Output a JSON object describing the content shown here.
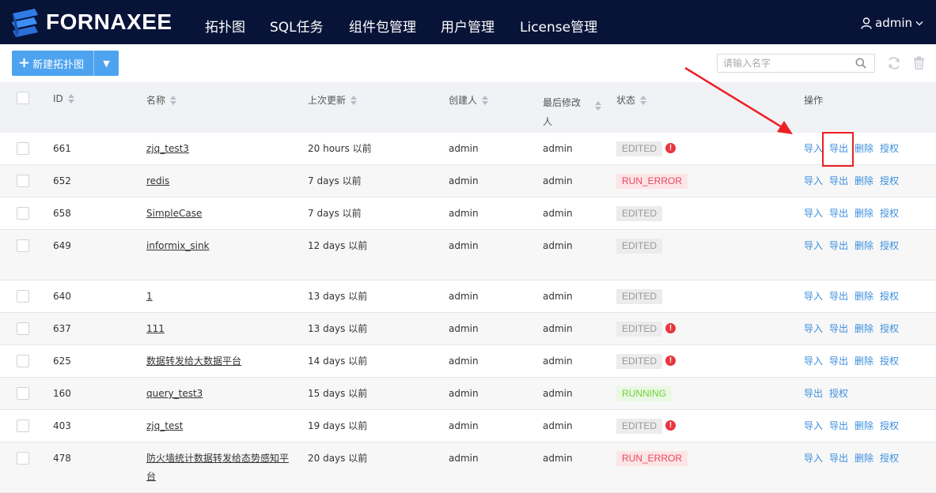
{
  "header": {
    "brand": "FORNAXEE",
    "nav": [
      "拓扑图",
      "SQL任务",
      "组件包管理",
      "用户管理",
      "License管理"
    ],
    "user": "admin"
  },
  "toolbar": {
    "new_label": "新建拓扑图",
    "search_placeholder": "请输入名字"
  },
  "table": {
    "columns": {
      "id": "ID",
      "name": "名称",
      "updated": "上次更新",
      "creator": "创建人",
      "last_modifier": "最后修改人",
      "status": "状态",
      "actions": "操作"
    },
    "action_labels": {
      "import": "导入",
      "export": "导出",
      "delete": "删除",
      "authorize": "授权"
    },
    "rows": [
      {
        "id": "661",
        "name": "zjq_test3",
        "updated": "20 hours 以前",
        "creator": "admin",
        "modifier": "admin",
        "status": "EDITED",
        "warning": true,
        "actions": [
          "导入",
          "导出",
          "删除",
          "授权"
        ]
      },
      {
        "id": "652",
        "name": "redis",
        "updated": "7 days 以前",
        "creator": "admin",
        "modifier": "admin",
        "status": "RUN_ERROR",
        "warning": false,
        "actions": [
          "导入",
          "导出",
          "删除",
          "授权"
        ]
      },
      {
        "id": "658",
        "name": "SimpleCase",
        "updated": "7 days 以前",
        "creator": "admin",
        "modifier": "admin",
        "status": "EDITED",
        "warning": false,
        "actions": [
          "导入",
          "导出",
          "删除",
          "授权"
        ]
      },
      {
        "id": "649",
        "name": "informix_sink",
        "updated": "12 days 以前",
        "creator": "admin",
        "modifier": "admin",
        "status": "EDITED",
        "warning": false,
        "actions": [
          "导入",
          "导出",
          "删除",
          "授权"
        ]
      },
      {
        "id": "640",
        "name": "1",
        "updated": "13 days 以前",
        "creator": "admin",
        "modifier": "admin",
        "status": "EDITED",
        "warning": false,
        "actions": [
          "导入",
          "导出",
          "删除",
          "授权"
        ]
      },
      {
        "id": "637",
        "name": "111",
        "updated": "13 days 以前",
        "creator": "admin",
        "modifier": "admin",
        "status": "EDITED",
        "warning": true,
        "actions": [
          "导入",
          "导出",
          "删除",
          "授权"
        ]
      },
      {
        "id": "625",
        "name": "数据转发给大数据平台",
        "updated": "14 days 以前",
        "creator": "admin",
        "modifier": "admin",
        "status": "EDITED",
        "warning": true,
        "actions": [
          "导入",
          "导出",
          "删除",
          "授权"
        ]
      },
      {
        "id": "160",
        "name": "query_test3",
        "updated": "15 days 以前",
        "creator": "admin",
        "modifier": "admin",
        "status": "RUNNING",
        "warning": false,
        "actions": [
          "导出",
          "授权"
        ]
      },
      {
        "id": "403",
        "name": "zjq_test",
        "updated": "19 days 以前",
        "creator": "admin",
        "modifier": "admin",
        "status": "EDITED",
        "warning": true,
        "actions": [
          "导入",
          "导出",
          "删除",
          "授权"
        ]
      },
      {
        "id": "478",
        "name": "防火墙统计数据转发给态势感知平台",
        "updated": "20 days 以前",
        "creator": "admin",
        "modifier": "admin",
        "status": "RUN_ERROR",
        "warning": false,
        "actions": [
          "导入",
          "导出",
          "删除",
          "授权"
        ]
      }
    ]
  },
  "colors": {
    "topbar": "#081338",
    "primary": "#4da3ef",
    "link": "#3b8fde",
    "edited_bg": "#ececec",
    "error": "#e8465b",
    "running": "#73d13d",
    "annotation": "#ee1f24"
  },
  "icons": [
    "logo-icon",
    "user-icon",
    "chevron-down-icon",
    "plus-icon",
    "caret-down-icon",
    "search-icon",
    "refresh-icon",
    "trash-icon",
    "warning-icon",
    "sort-icon"
  ]
}
